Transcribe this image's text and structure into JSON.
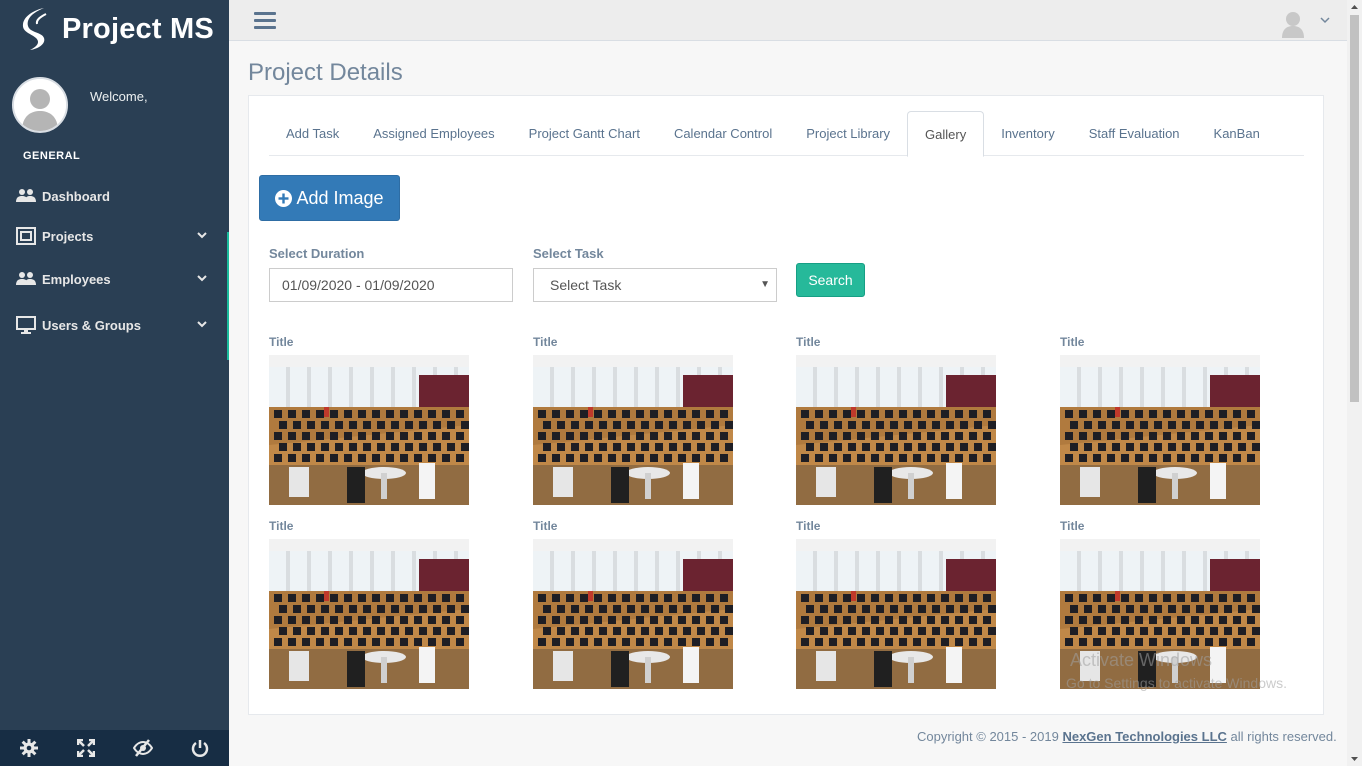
{
  "brand": {
    "title": "Project MS"
  },
  "profile": {
    "welcome": "Welcome,"
  },
  "sidebar": {
    "section": "GENERAL",
    "items": [
      {
        "label": "Dashboard",
        "icon": "users-icon",
        "expandable": false
      },
      {
        "label": "Projects",
        "icon": "project-icon",
        "expandable": true
      },
      {
        "label": "Employees",
        "icon": "users-icon",
        "expandable": true
      },
      {
        "label": "Users & Groups",
        "icon": "desktop-icon",
        "expandable": true
      }
    ],
    "footer_icons": [
      "gear-icon",
      "fullscreen-icon",
      "eye-slash-icon",
      "power-icon"
    ]
  },
  "page": {
    "title": "Project Details"
  },
  "tabs": [
    {
      "label": "Add Task",
      "active": false
    },
    {
      "label": "Assigned Employees",
      "active": false
    },
    {
      "label": "Project Gantt Chart",
      "active": false
    },
    {
      "label": "Calendar Control",
      "active": false
    },
    {
      "label": "Project Library",
      "active": false
    },
    {
      "label": "Gallery",
      "active": true
    },
    {
      "label": "Inventory",
      "active": false
    },
    {
      "label": "Staff Evaluation",
      "active": false
    },
    {
      "label": "KanBan",
      "active": false
    }
  ],
  "gallery": {
    "add_button": "Add Image",
    "duration_label": "Select Duration",
    "duration_value": "01/09/2020 - 01/09/2020",
    "task_label": "Select Task",
    "task_value": "Select Task",
    "search_button": "Search",
    "items": [
      {
        "title": "Title"
      },
      {
        "title": "Title"
      },
      {
        "title": "Title"
      },
      {
        "title": "Title"
      },
      {
        "title": "Title"
      },
      {
        "title": "Title"
      },
      {
        "title": "Title"
      },
      {
        "title": "Title"
      }
    ]
  },
  "watermark": {
    "line1": "Activate Windows",
    "line2": "Go to Settings to activate Windows."
  },
  "footer": {
    "prefix": "Copyright © 2015 - 2019 ",
    "company": "NexGen Technologies LLC",
    "suffix": " all rights reserved."
  },
  "colors": {
    "sidebar": "#2a3f54",
    "accent": "#1abb9c",
    "primary": "#337ab7",
    "success": "#26b99a"
  }
}
